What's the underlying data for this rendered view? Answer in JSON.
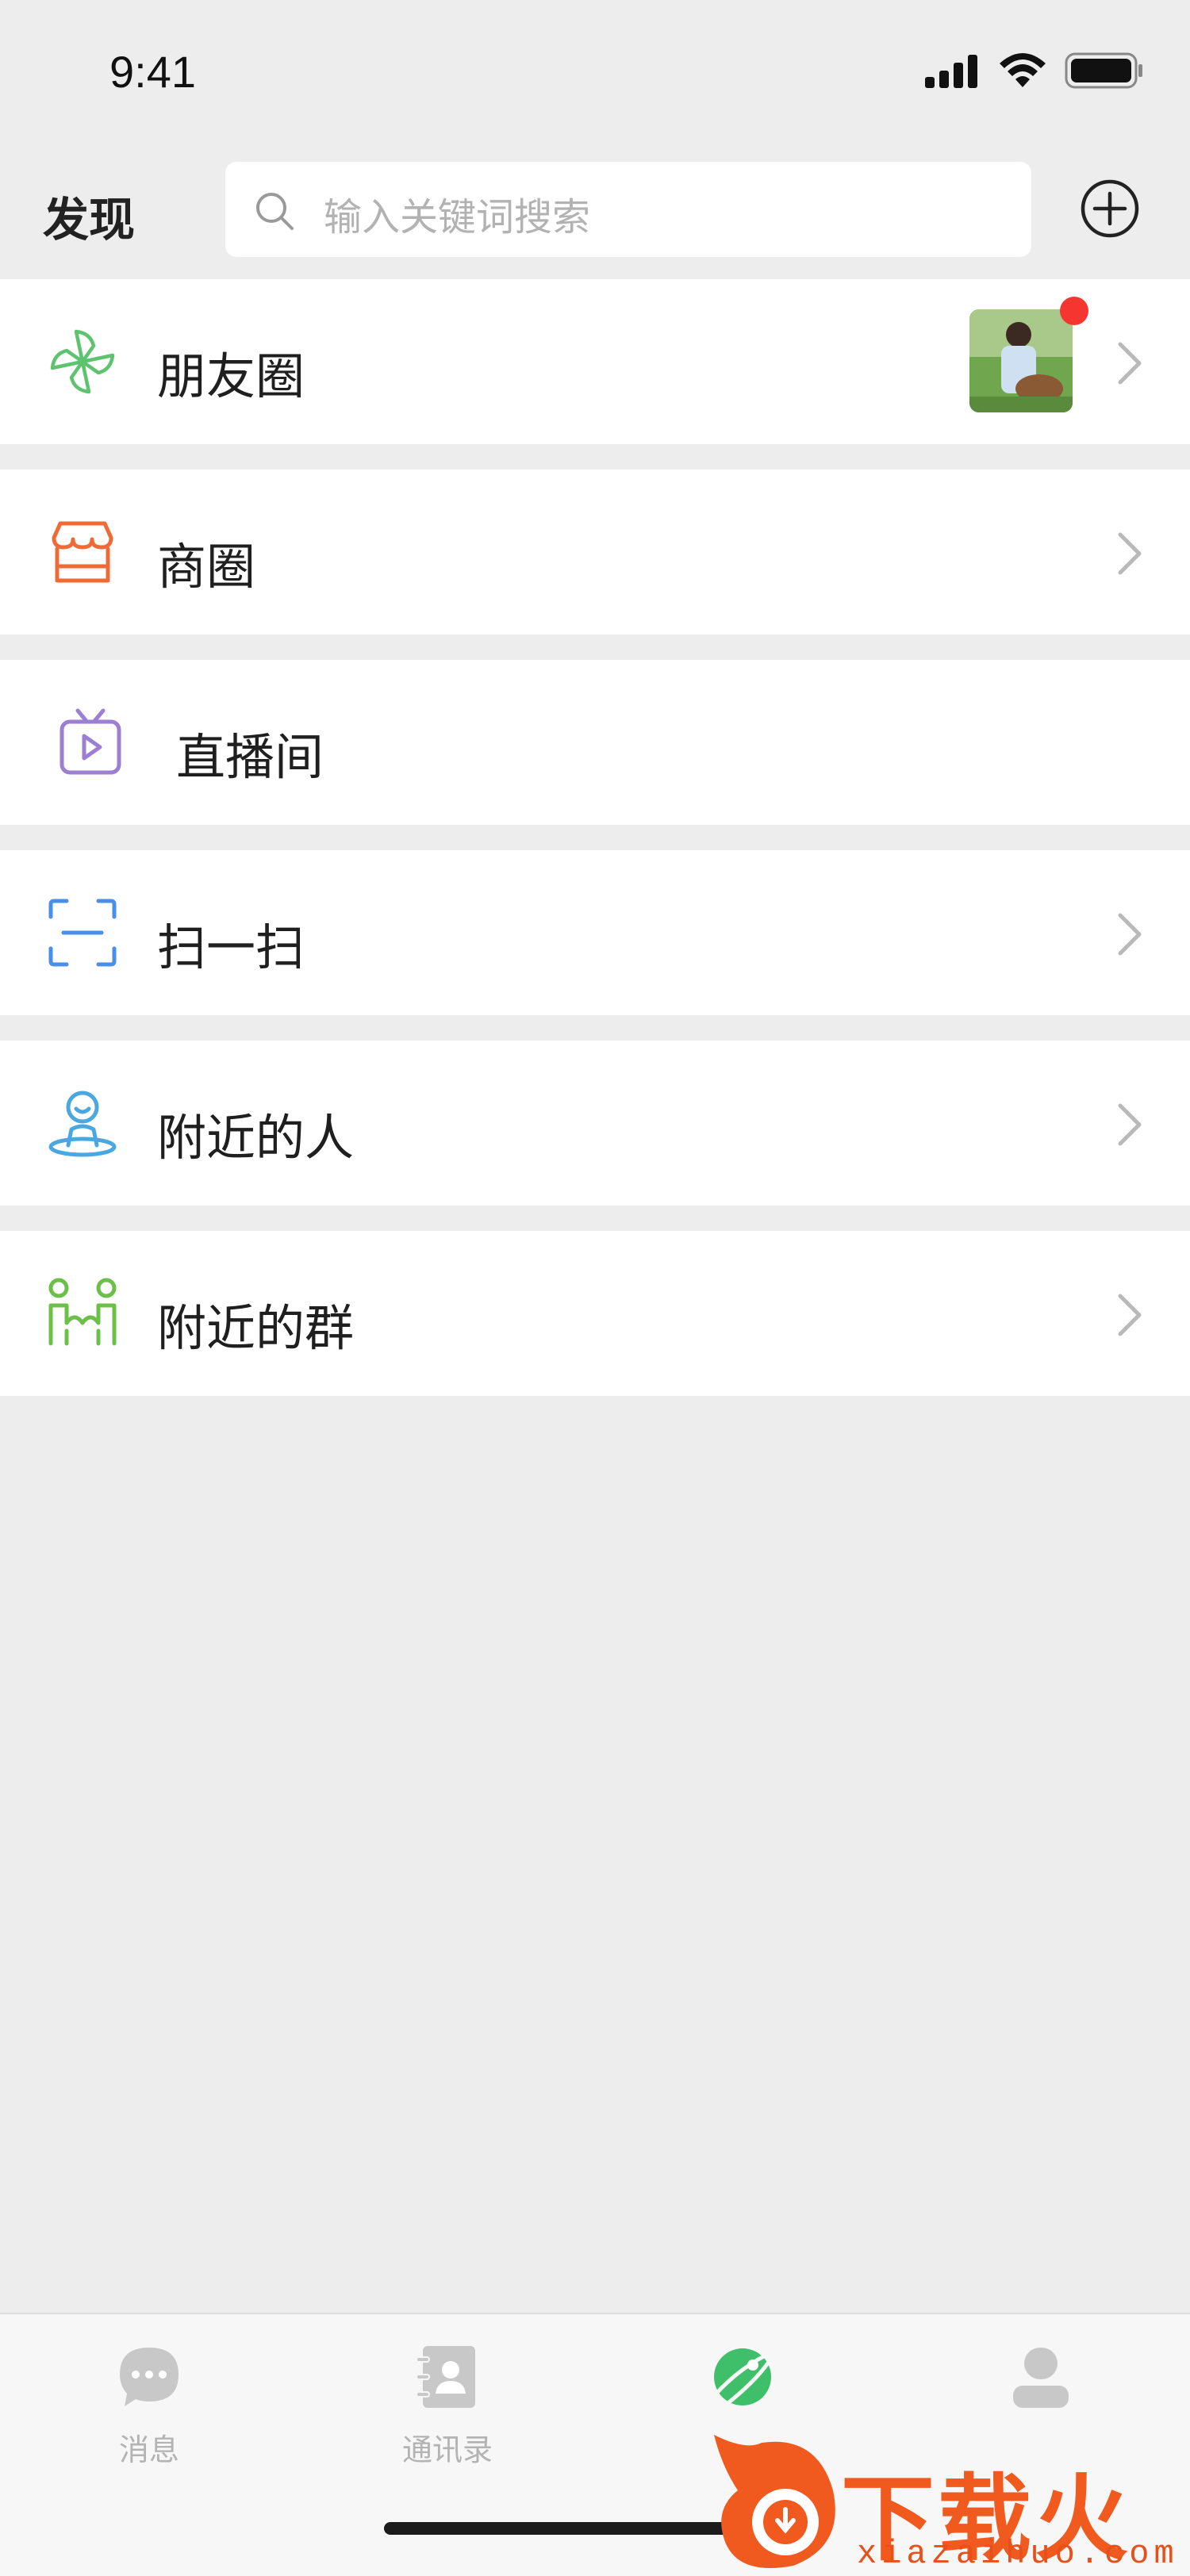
{
  "status_bar": {
    "time": "9:41"
  },
  "header": {
    "title": "发现",
    "search": {
      "placeholder": "输入关键词搜索",
      "icon": "search-icon"
    },
    "add_icon": "plus-circle-icon"
  },
  "menu": [
    {
      "label": "朋友圈",
      "icon": "moments-pinwheel-icon",
      "color": "#5ec36e",
      "has_thumbnail": true,
      "has_badge": true,
      "has_chevron": true
    },
    {
      "label": "商圈",
      "icon": "storefront-icon",
      "color": "#f06a35",
      "has_chevron": true
    },
    {
      "label": "直播间",
      "icon": "live-tv-icon",
      "color": "#9b7fd1",
      "has_chevron": false
    },
    {
      "label": "扫一扫",
      "icon": "scan-icon",
      "color": "#4a8fe7",
      "has_chevron": true
    },
    {
      "label": "附近的人",
      "icon": "nearby-person-icon",
      "color": "#4aa7e0",
      "has_chevron": true
    },
    {
      "label": "附近的群",
      "icon": "nearby-group-icon",
      "color": "#6cc04a",
      "has_chevron": true
    }
  ],
  "tab_bar": {
    "tabs": [
      {
        "label": "消息",
        "icon": "chat-bubble-icon",
        "active": false
      },
      {
        "label": "通讯录",
        "icon": "contacts-book-icon",
        "active": false
      },
      {
        "label": "",
        "icon": "planet-icon",
        "active": true
      },
      {
        "label": "",
        "icon": "profile-icon",
        "active": false
      }
    ]
  },
  "watermark": {
    "text": "下载火",
    "url": "xiazaihuo.com"
  },
  "colors": {
    "background": "#ededed",
    "card": "#ffffff",
    "accent_green": "#3fbf6a",
    "badge_red": "#f43530"
  }
}
